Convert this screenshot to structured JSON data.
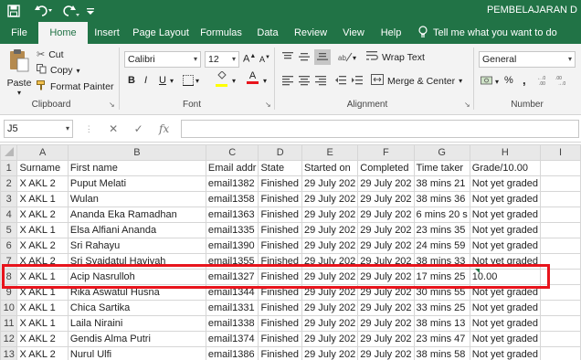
{
  "title_bar": {
    "title": "PEMBELAJARAN D"
  },
  "tabs": [
    "File",
    "Home",
    "Insert",
    "Page Layout",
    "Formulas",
    "Data",
    "Review",
    "View",
    "Help"
  ],
  "active_tab": "Home",
  "tell_me": "Tell me what you want to do",
  "clipboard": {
    "paste": "Paste",
    "cut": "Cut",
    "copy": "Copy",
    "format_painter": "Format Painter",
    "label": "Clipboard"
  },
  "font": {
    "name": "Calibri",
    "size": "12",
    "bold": "B",
    "italic": "I",
    "underline": "U",
    "font_color": "A",
    "label": "Font"
  },
  "alignment": {
    "wrap_text": "Wrap Text",
    "merge_center": "Merge & Center",
    "label": "Alignment"
  },
  "number": {
    "format": "General",
    "percent": "%",
    "comma": ",",
    "label": "Number"
  },
  "formula_bar": {
    "name_box": "J5",
    "cancel": "✕",
    "enter": "✓",
    "fx": "fx",
    "formula": ""
  },
  "columns": [
    "A",
    "B",
    "C",
    "D",
    "E",
    "F",
    "G",
    "H",
    "I"
  ],
  "rows": [
    {
      "n": "1",
      "cells": [
        "Surname",
        "First name",
        "Email addr",
        "State",
        "Started on",
        "Completed",
        "Time taker",
        "Grade/10.00",
        ""
      ]
    },
    {
      "n": "2",
      "cells": [
        "X AKL 2",
        "Puput Melati",
        "email1382",
        "Finished",
        "29 July 202",
        "29 July 202",
        "38 mins 21",
        "Not yet graded",
        ""
      ]
    },
    {
      "n": "3",
      "cells": [
        "X AKL 1",
        "Wulan",
        "email1358",
        "Finished",
        "29 July 202",
        "29 July 202",
        "38 mins 36",
        "Not yet graded",
        ""
      ]
    },
    {
      "n": "4",
      "cells": [
        "X AKL 2",
        "Ananda Eka Ramadhan",
        "email1363",
        "Finished",
        "29 July 202",
        "29 July 202",
        "6 mins 20 s",
        "Not yet graded",
        ""
      ]
    },
    {
      "n": "5",
      "cells": [
        "X AKL 1",
        "Elsa Alfiani Ananda",
        "email1335",
        "Finished",
        "29 July 202",
        "29 July 202",
        "23 mins 35",
        "Not yet graded",
        ""
      ]
    },
    {
      "n": "6",
      "cells": [
        "X AKL 2",
        "Sri Rahayu",
        "email1390",
        "Finished",
        "29 July 202",
        "29 July 202",
        "24 mins 59",
        "Not yet graded",
        ""
      ]
    },
    {
      "n": "7",
      "cells": [
        "X AKL 2",
        "Sri Syaidatul Hayiyah",
        "email1355",
        "Finished",
        "29 July 202",
        "29 July 202",
        "38 mins 33",
        "Not yet graded",
        ""
      ]
    },
    {
      "n": "8",
      "cells": [
        "X AKL 1",
        "Acip Nasrulloh",
        "email1327",
        "Finished",
        "29 July 202",
        "29 July 202",
        "17 mins 25",
        "10.00",
        ""
      ]
    },
    {
      "n": "9",
      "cells": [
        "X AKL 1",
        "Rika Aswatul Husna",
        "email1344",
        "Finished",
        "29 July 202",
        "29 July 202",
        "30 mins 55",
        "Not yet graded",
        ""
      ]
    },
    {
      "n": "10",
      "cells": [
        "X AKL 1",
        "Chica Sartika",
        "email1331",
        "Finished",
        "29 July 202",
        "29 July 202",
        "33 mins 25",
        "Not yet graded",
        ""
      ]
    },
    {
      "n": "11",
      "cells": [
        "X AKL 1",
        "Laila Niraini",
        "email1338",
        "Finished",
        "29 July 202",
        "29 July 202",
        "38 mins 13",
        "Not yet graded",
        ""
      ]
    },
    {
      "n": "12",
      "cells": [
        "X AKL 2",
        "Gendis Alma Putri",
        "email1374",
        "Finished",
        "29 July 202",
        "29 July 202",
        "23 mins 47",
        "Not yet graded",
        ""
      ]
    },
    {
      "n": "13",
      "cells": [
        "X AKL 2",
        "Nurul Ulfi",
        "email1386",
        "Finished",
        "29 July 202",
        "29 July 202",
        "38 mins 58",
        "Not yet graded",
        ""
      ]
    }
  ],
  "colors": {
    "excel_green": "#217346",
    "highlight": "#e8141c",
    "font_color_bar": "#e8141c",
    "fill_color_bar": "#ffff00"
  }
}
